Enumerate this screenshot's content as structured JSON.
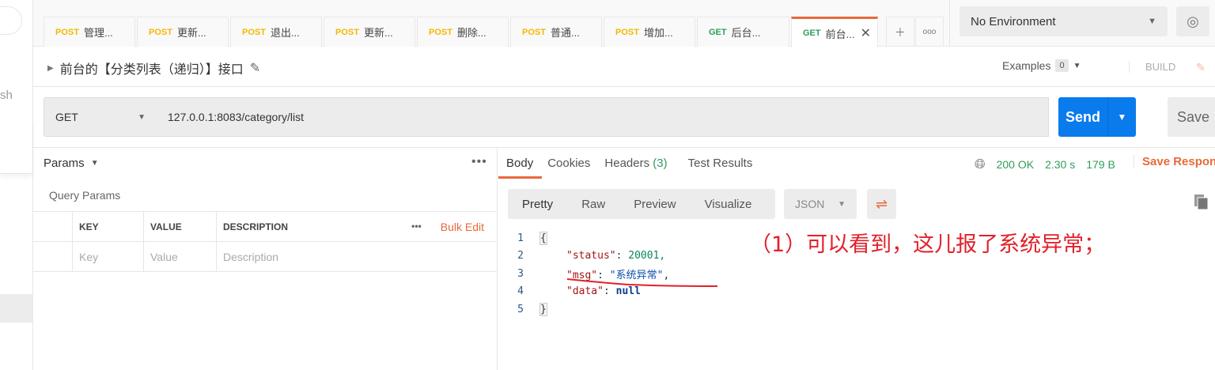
{
  "sidebar": {
    "partial_text": "sh"
  },
  "tabs": [
    {
      "method": "POST",
      "label": "管理..."
    },
    {
      "method": "POST",
      "label": "更新..."
    },
    {
      "method": "POST",
      "label": "退出..."
    },
    {
      "method": "POST",
      "label": "更新..."
    },
    {
      "method": "POST",
      "label": "删除..."
    },
    {
      "method": "POST",
      "label": "普通..."
    },
    {
      "method": "POST",
      "label": "增加..."
    },
    {
      "method": "GET",
      "label": "后台..."
    },
    {
      "method": "GET",
      "label": "前台...",
      "active": true
    }
  ],
  "environment": {
    "selected": "No Environment"
  },
  "request": {
    "title": "前台的【分类列表（递归）】接口",
    "examples_label": "Examples",
    "examples_count": "0",
    "build_label": "BUILD",
    "method": "GET",
    "url": "127.0.0.1:8083/category/list",
    "send_label": "Send",
    "save_label": "Save"
  },
  "params": {
    "label": "Params",
    "query_label": "Query Params",
    "headers": [
      "KEY",
      "VALUE",
      "DESCRIPTION"
    ],
    "bulk_edit": "Bulk Edit",
    "placeholders": [
      "Key",
      "Value",
      "Description"
    ]
  },
  "response": {
    "tabs": [
      "Body",
      "Cookies",
      "Headers",
      "Test Results"
    ],
    "headers_count": "(3)",
    "status": "200 OK",
    "time": "2.30 s",
    "size": "179 B",
    "save_label": "Save Response",
    "views": [
      "Pretty",
      "Raw",
      "Preview",
      "Visualize"
    ],
    "format": "JSON",
    "lines": [
      {
        "n": "1",
        "t": "{"
      },
      {
        "n": "2",
        "key": "\"status\"",
        "val": "20001,"
      },
      {
        "n": "3",
        "key": "\"msg\"",
        "val": "\"系统异常\"",
        "tail": ","
      },
      {
        "n": "4",
        "key": "\"data\"",
        "val": "null"
      },
      {
        "n": "5",
        "t": "}"
      }
    ]
  },
  "annotation": "（1）可以看到，这儿报了系统异常；",
  "colors": {
    "accent": "#e8693a",
    "send": "#097bed",
    "get": "#2f9e5a",
    "post": "#f5b800",
    "annotation": "#e2202a"
  }
}
